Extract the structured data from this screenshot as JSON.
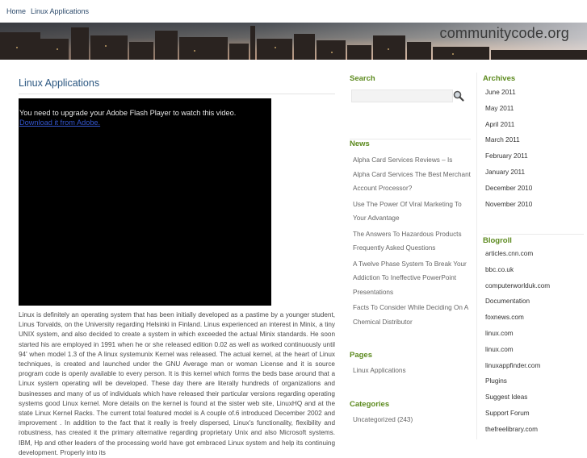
{
  "nav": {
    "home": "Home",
    "current": "Linux Applications"
  },
  "header": {
    "brand": "communitycode.org"
  },
  "main": {
    "title": "Linux Applications",
    "flash_message": "You need to upgrade your Adobe Flash Player to watch this video.",
    "flash_link": "Download it from Adobe.",
    "article": "Linux is definitely an operating system that has been initially developed as a pastime by a younger student, Linus Torvalds, on the University regarding Helsinki in Finland. Linus experienced an interest in Minix, a tiny UNIX system, and also decided to create a system in which exceeded the actual Minix standards. He soon started his are employed in 1991 when he or she released edition 0.02 as well as worked continuously until 94' when model 1.3 of the A linux systemunix Kernel was released. The actual kernel, at the heart of Linux techniques, is created and launched under the GNU Average man or woman License and it is source program code is openly available to every person. It is this kernel which forms the beds base around that a Linux system operating will be developed. These day there are literally hundreds of organizations and businesses and many of us of individuals which have released their particular versions regarding operating systems good Linux kernel. More details on the kernel is found at the sister web site, LinuxHQ and at the state Linux Kernel Racks. The current total featured model is A couple of.6 introduced December 2002 and improvement . In addition to the fact that it really is freely dispersed, Linux's functionality, flexibility and robustness, has created it the primary alternative regarding proprietary Unix and also Microsoft systems. IBM, Hp and other leaders of the processing world have got embraced Linux system and help its continuing development. Properly into its"
  },
  "sidebar": {
    "search_title": "Search",
    "search_placeholder": "",
    "search_icon": "magnifier-icon",
    "news_title": "News",
    "news": [
      "Alpha Card Services Reviews – Is Alpha Card Services The Best Merchant Account Processor?",
      "Use The Power Of Viral Marketing To Your Advantage",
      "The Answers To Hazardous Products Frequently Asked Questions",
      "A Twelve Phase System To Break Your Addiction To Ineffective PowerPoint Presentations",
      "Facts To Consider While Deciding On A Chemical Distributor"
    ],
    "pages_title": "Pages",
    "pages": [
      "Linux Applications"
    ],
    "categories_title": "Categories",
    "categories": [
      "Uncategorized (243)"
    ]
  },
  "sidebar2": {
    "archives_title": "Archives",
    "archives": [
      "June 2011",
      "May 2011",
      "April 2011",
      "March 2011",
      "February 2011",
      "January 2011",
      "December 2010",
      "November 2010"
    ],
    "blogroll_title": "Blogroll",
    "blogroll": [
      "articles.cnn.com",
      "bbc.co.uk",
      "computerworlduk.com",
      "Documentation",
      "foxnews.com",
      "linux.com",
      "linux.com",
      "linuxappfinder.com",
      "Plugins",
      "Suggest Ideas",
      "Support Forum",
      "thefreelibrary.com"
    ]
  },
  "colors": {
    "accent_green": "#5c8a1e",
    "title_blue": "#2a5680"
  }
}
